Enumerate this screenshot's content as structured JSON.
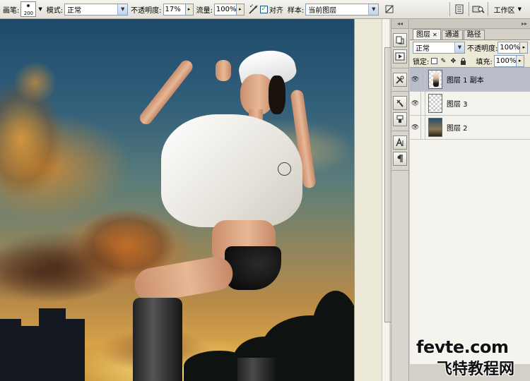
{
  "options_bar": {
    "brush_label": "画笔:",
    "brush_size": "200",
    "mode_label": "模式:",
    "mode_value": "正常",
    "opacity_label": "不透明度:",
    "opacity_value": "17%",
    "flow_label": "流量:",
    "flow_value": "100%",
    "aligned_label": "对齐",
    "aligned_checked": true,
    "sample_label": "样本:",
    "sample_value": "当前图层",
    "workspace_label": "工作区"
  },
  "dock": {
    "collapse_glyph": "◂◂"
  },
  "layers_panel": {
    "collapse_glyph": "▸▸",
    "tabs": [
      {
        "label": "图层",
        "active": true
      },
      {
        "label": "通道",
        "active": false
      },
      {
        "label": "路径",
        "active": false
      }
    ],
    "blend_mode": "正常",
    "opacity_label": "不透明度:",
    "opacity_value": "100%",
    "lock_label": "锁定:",
    "fill_label": "填充:",
    "fill_value": "100%",
    "layers": [
      {
        "name": "图层 1 副本",
        "selected": true,
        "thumb": "girl"
      },
      {
        "name": "图层 3",
        "selected": false,
        "thumb": "transparent"
      },
      {
        "name": "图层 2",
        "selected": false,
        "thumb": "sky"
      }
    ]
  },
  "watermark": {
    "line1": "fevte.com",
    "line2": "飞特教程网"
  }
}
